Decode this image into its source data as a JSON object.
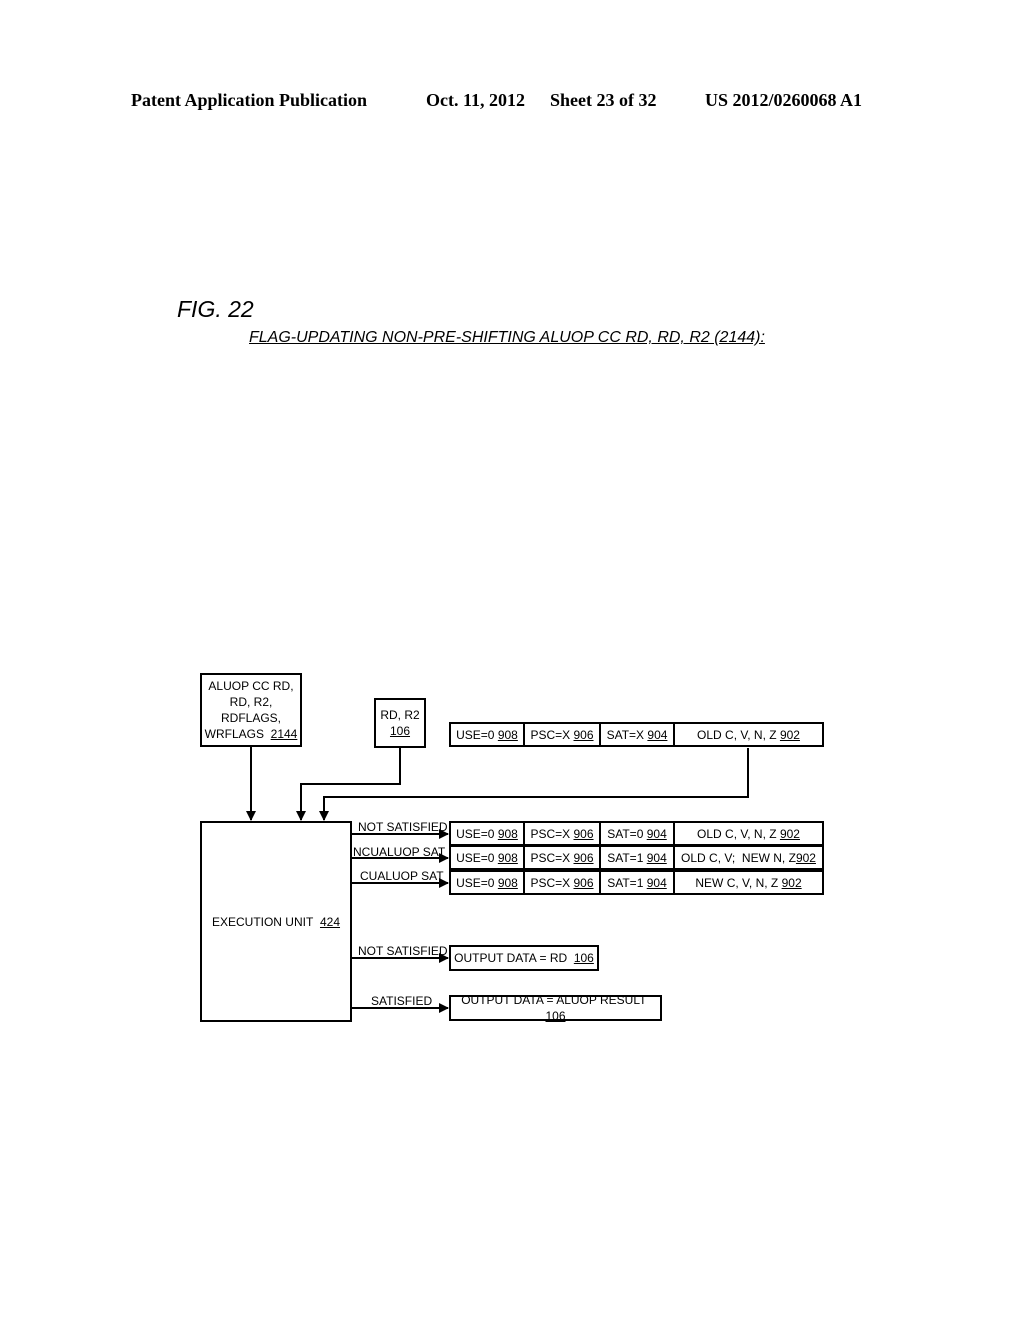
{
  "header": {
    "publication": "Patent Application Publication",
    "date": "Oct. 11, 2012",
    "sheet": "Sheet 23 of 32",
    "patent_number": "US 2012/0260068 A1"
  },
  "figure": {
    "label": "FIG. 22",
    "title": "FLAG-UPDATING NON-PRE-SHIFTING ALUOP CC RD, RD, R2 (2144):"
  },
  "instruction_box": {
    "lines": [
      "ALUOP CC RD,",
      "RD, R2,",
      "RDFLAGS,",
      "WRFLAGS"
    ],
    "ref": "2144"
  },
  "operand_box": {
    "text": "RD, R2",
    "ref": "106"
  },
  "execution_unit": {
    "text": "EXECUTION UNIT",
    "ref": "424"
  },
  "input_flags": {
    "cells": [
      {
        "text": "USE=0",
        "ref": "908"
      },
      {
        "text": "PSC=X",
        "ref": "906"
      },
      {
        "text": "SAT=X",
        "ref": "904"
      },
      {
        "text": "OLD C, V, N, Z",
        "ref": "902"
      }
    ]
  },
  "flag_outputs": [
    {
      "label": "NOT SATISFIED",
      "cells": [
        {
          "text": "USE=0",
          "ref": "908"
        },
        {
          "text": "PSC=X",
          "ref": "906"
        },
        {
          "text": "SAT=0",
          "ref": "904"
        },
        {
          "text": "OLD C, V, N, Z",
          "ref": "902"
        }
      ]
    },
    {
      "label": "NCUALUOP SAT",
      "cells": [
        {
          "text": "USE=0",
          "ref": "908"
        },
        {
          "text": "PSC=X",
          "ref": "906"
        },
        {
          "text": "SAT=1",
          "ref": "904"
        },
        {
          "text": "OLD C, V;  NEW N, Z",
          "ref": "902"
        }
      ]
    },
    {
      "label": "CUALUOP SAT",
      "cells": [
        {
          "text": "USE=0",
          "ref": "908"
        },
        {
          "text": "PSC=X",
          "ref": "906"
        },
        {
          "text": "SAT=1",
          "ref": "904"
        },
        {
          "text": "NEW C, V, N, Z",
          "ref": "902"
        }
      ]
    }
  ],
  "data_outputs": [
    {
      "label": "NOT SATISFIED",
      "text": "OUTPUT DATA = RD",
      "ref": "106"
    },
    {
      "label": "SATISFIED",
      "text": "OUTPUT DATA = ALUOP RESULT",
      "ref": "106"
    }
  ]
}
